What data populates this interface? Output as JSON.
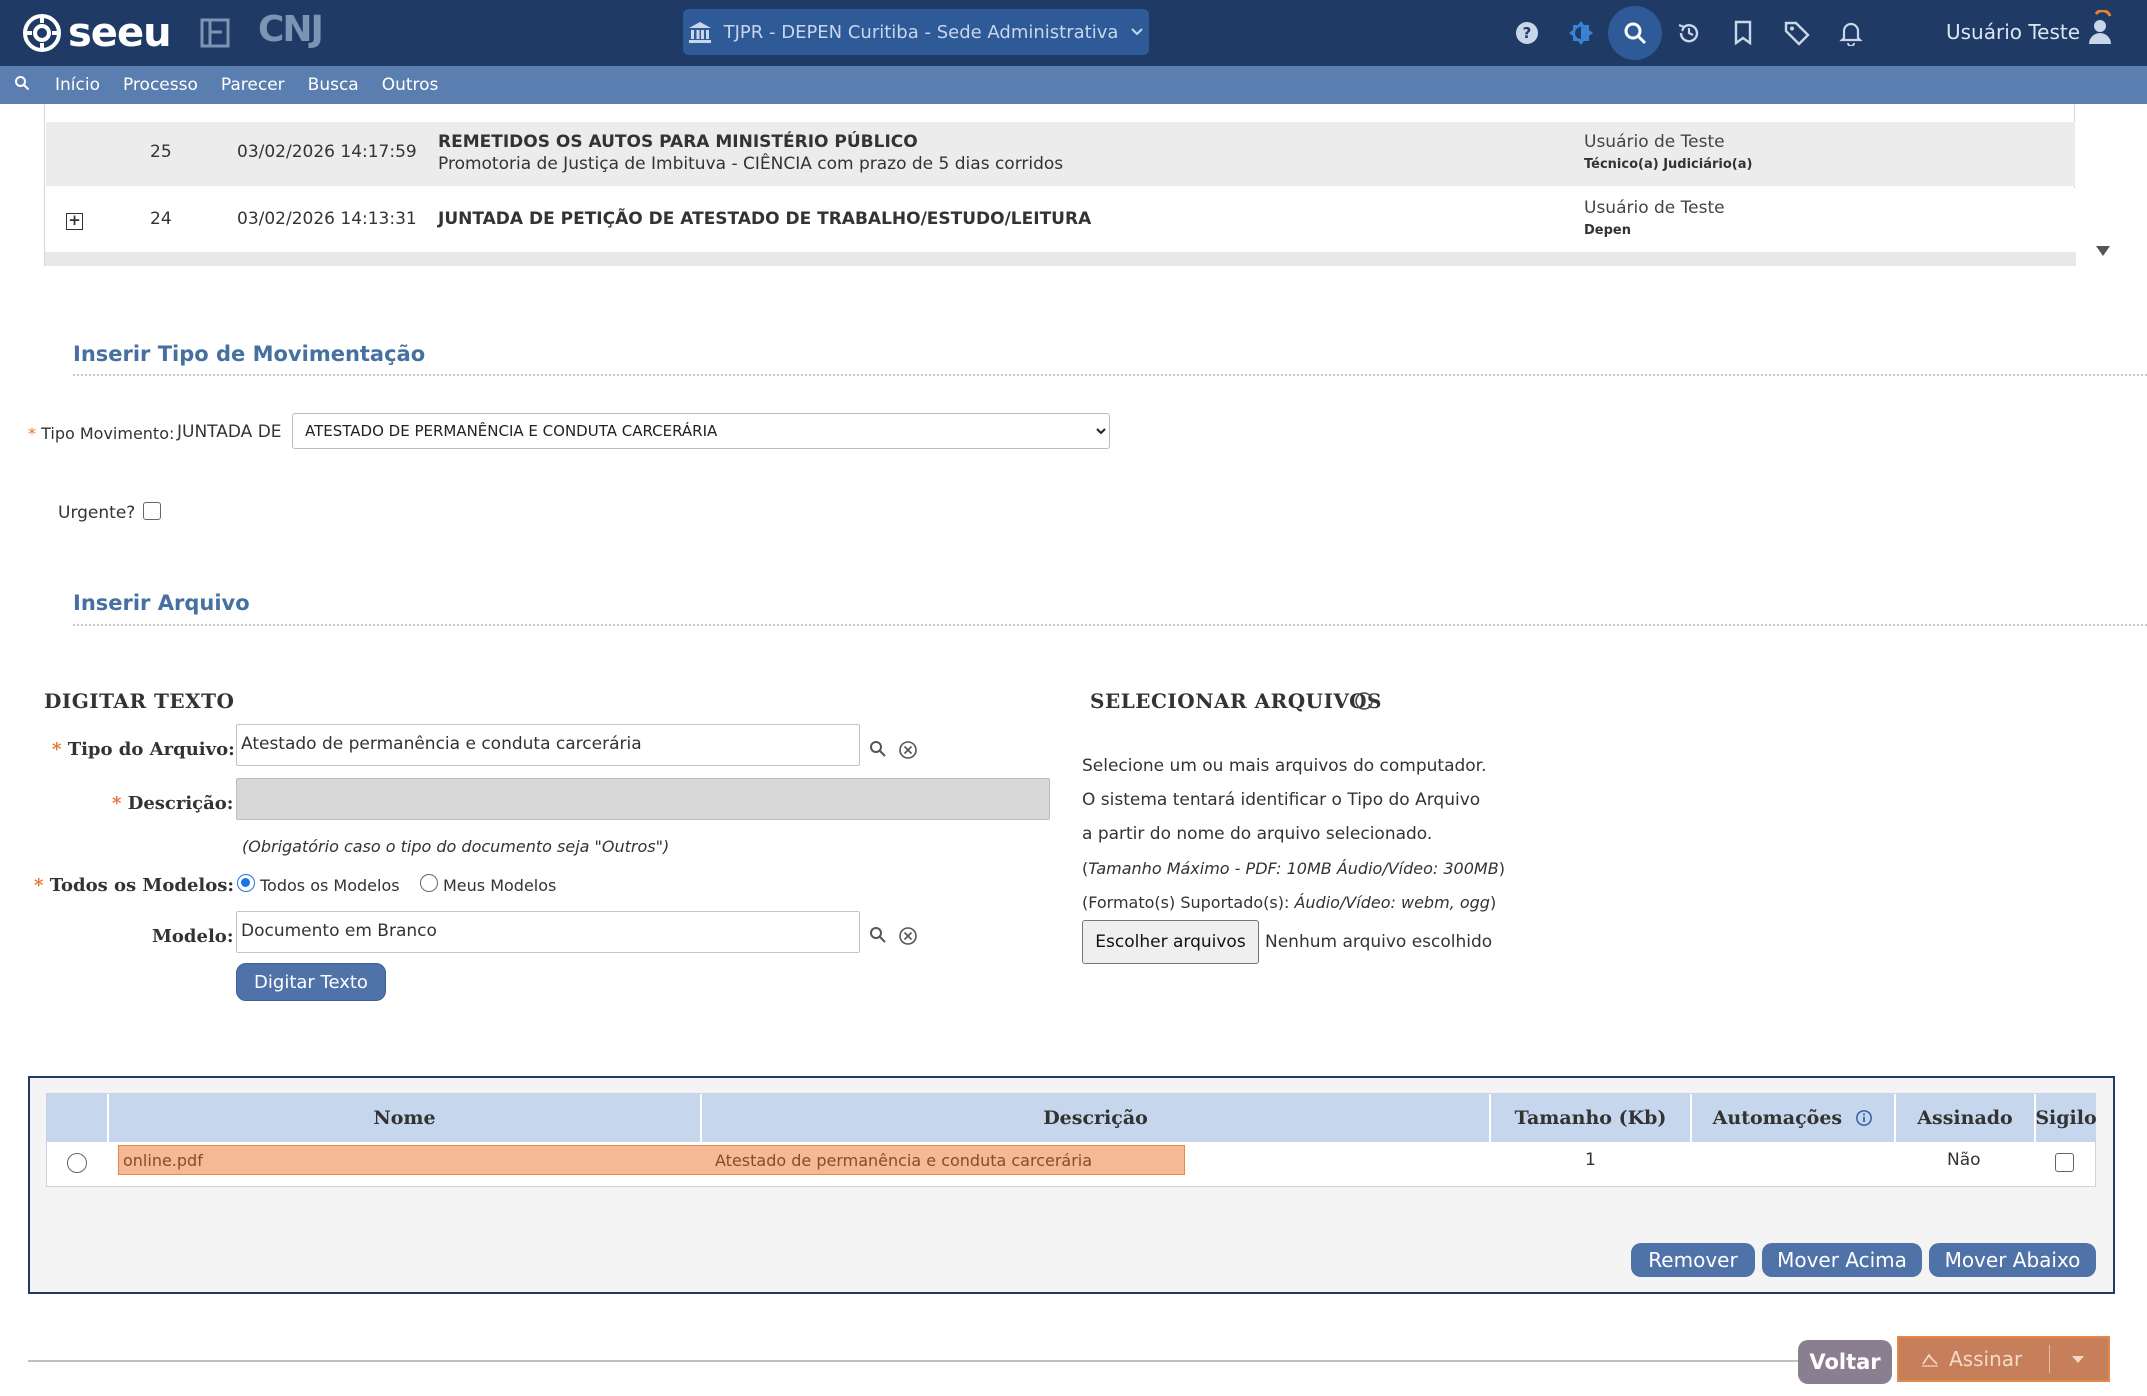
{
  "header": {
    "logo_text": "seeu",
    "cnj_text": "CNJ",
    "unit_selector": "TJPR - DEPEN Curitiba - Sede Administrativa",
    "user_name": "Usuário Teste",
    "icons": [
      "help-icon",
      "theme-icon",
      "search-icon",
      "history-icon",
      "bookmark-icon",
      "tag-icon",
      "bell-icon",
      "user-avatar-icon"
    ]
  },
  "nav": {
    "items": [
      {
        "label": "Início"
      },
      {
        "label": "Processo"
      },
      {
        "label": "Parecer"
      },
      {
        "label": "Busca"
      },
      {
        "label": "Outros"
      }
    ]
  },
  "movements": [
    {
      "seq": "25",
      "date": "03/02/2026 14:17:59",
      "title": "REMETIDOS OS AUTOS PARA MINISTÉRIO PÚBLICO",
      "subtitle": "Promotoria de Justiça de Imbituva - CIÊNCIA com prazo de 5 dias corridos",
      "user": "Usuário de Teste",
      "role": "Técnico(a) Judiciário(a)"
    },
    {
      "seq": "24",
      "date": "03/02/2026 14:13:31",
      "title": "JUNTADA DE PETIÇÃO DE ATESTADO DE TRABALHO/ESTUDO/LEITURA",
      "subtitle": "",
      "user": "Usuário de Teste",
      "role": "Depen"
    }
  ],
  "insert_type": {
    "section_title": "Inserir Tipo de Movimentação",
    "tipo_label": "Tipo Movimento:",
    "juntada_prefix": "JUNTADA DE",
    "tipo_value": "ATESTADO DE PERMANÊNCIA E CONDUTA CARCERÁRIA",
    "urgente_label": "Urgente?"
  },
  "insert_file": {
    "section_title": "Inserir Arquivo",
    "digitar": {
      "heading": "DIGITAR TEXTO",
      "tipo_label": "Tipo do Arquivo:",
      "tipo_value": "Atestado de permanência e conduta carcerária",
      "descricao_label": "Descrição:",
      "descricao_value": "",
      "hint": "(Obrigatório caso o tipo do documento seja \"Outros\")",
      "modelos_label": "Todos os Modelos:",
      "radio_all": "Todos os Modelos",
      "radio_mine": "Meus Modelos",
      "modelo_label": "Modelo:",
      "modelo_value": "Documento em Branco",
      "button": "Digitar Texto"
    },
    "select": {
      "heading": "SELECIONAR ARQUIVOS",
      "line1": "Selecione um ou mais arquivos do computador.",
      "line2": "O sistema tentará identificar o Tipo do Arquivo",
      "line3": "a partir do nome do arquivo selecionado.",
      "limits_prefix": "(",
      "limits": "Tamanho Máximo - PDF: 10MB  Áudio/Vídeo: 300MB",
      "limits_suffix": ")",
      "formats_prefix": "(Formato(s) Suportado(s):",
      "formats": "Áudio/Vídeo: webm, ogg",
      "formats_suffix": ")",
      "choose_button": "Escolher arquivos",
      "no_file": "Nenhum arquivo escolhido"
    }
  },
  "files_table": {
    "columns": [
      "Nome",
      "Descrição",
      "Tamanho (Kb)",
      "Automações",
      "Assinado",
      "Sigilo"
    ],
    "rows": [
      {
        "nome": "online.pdf",
        "descricao": "Atestado de permanência e conduta carcerária",
        "tamanho": "1",
        "automacoes": "",
        "assinado": "Não"
      }
    ],
    "buttons": {
      "remover": "Remover",
      "mover_acima": "Mover Acima",
      "mover_abaixo": "Mover Abaixo"
    }
  },
  "footer": {
    "voltar": "Voltar",
    "assinar": "Assinar"
  },
  "colors": {
    "topbar": "#1f3a64",
    "navbar": "#5b7eb1",
    "accent": "#4f72a8",
    "highlight": "#f6b996",
    "required": "#e2732a"
  }
}
